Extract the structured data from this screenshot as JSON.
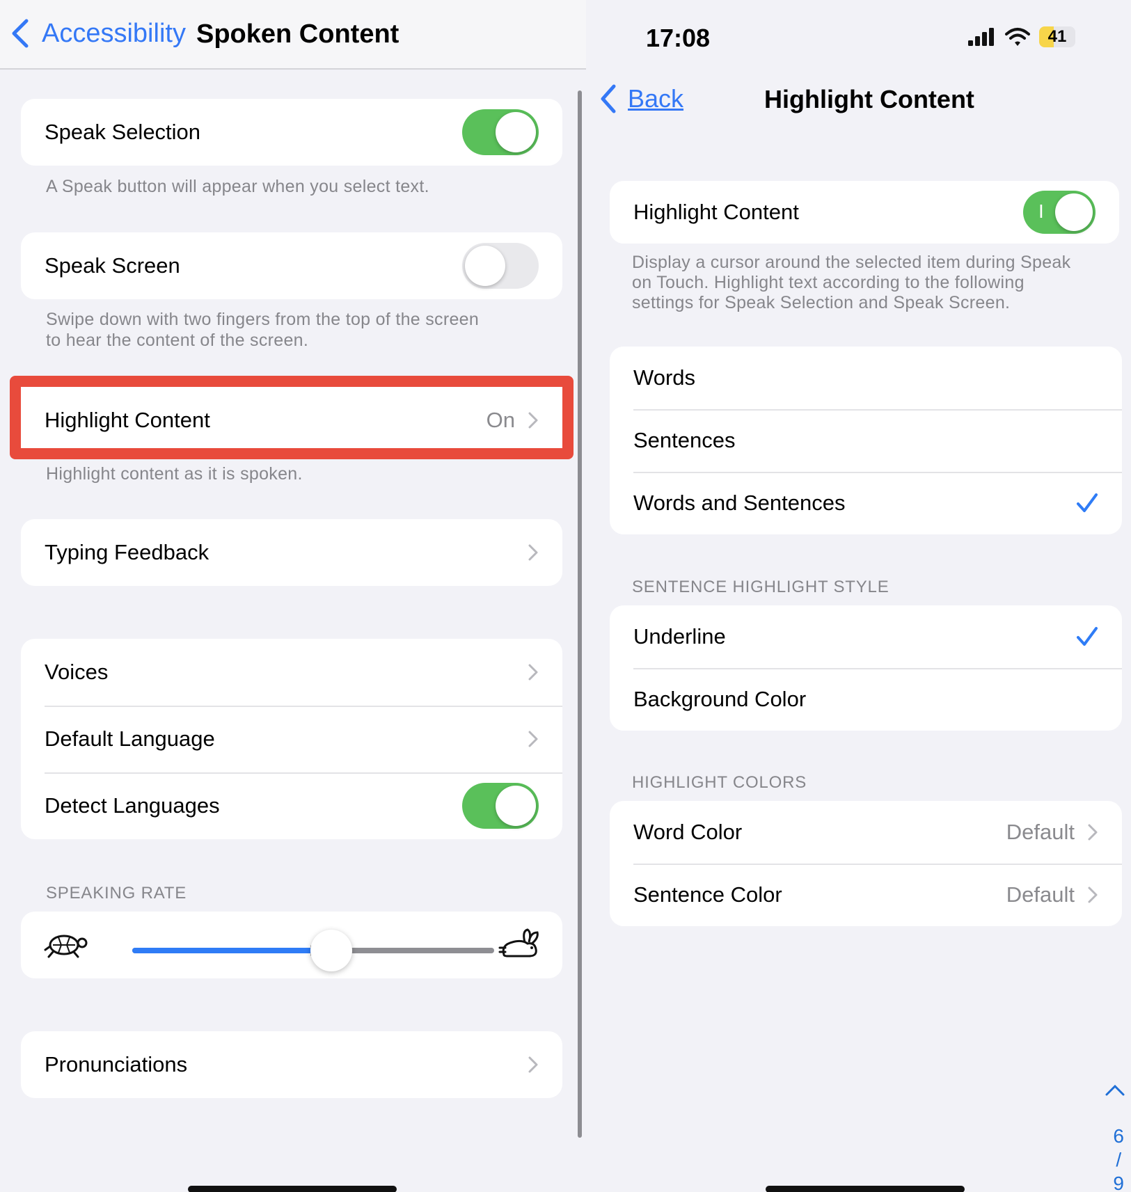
{
  "left": {
    "nav": {
      "back_label": "Accessibility",
      "title": "Spoken Content"
    },
    "speak_selection": {
      "label": "Speak Selection",
      "on": true,
      "note": "A Speak button will appear when you select text."
    },
    "speak_screen": {
      "label": "Speak Screen",
      "on": false,
      "note_line1": "Swipe down with two fingers from the top of the screen",
      "note_line2": "to hear the content of the screen."
    },
    "highlight_content": {
      "label": "Highlight Content",
      "value": "On",
      "note": "Highlight content as it is spoken."
    },
    "typing_feedback": {
      "label": "Typing Feedback"
    },
    "voices": {
      "label": "Voices"
    },
    "default_language": {
      "label": "Default Language"
    },
    "detect_languages": {
      "label": "Detect Languages",
      "on": true
    },
    "speaking_rate": {
      "header": "SPEAKING RATE",
      "value_fraction": 0.55,
      "slow_icon": "turtle-icon",
      "fast_icon": "rabbit-icon"
    },
    "pronunciations": {
      "label": "Pronunciations"
    }
  },
  "right": {
    "status": {
      "time": "17:08",
      "battery": "41",
      "battery_fraction": 0.41
    },
    "nav": {
      "back_label": "Back",
      "title": "Highlight Content"
    },
    "highlight_toggle": {
      "label": "Highlight Content",
      "on": true,
      "switch_mark": "I"
    },
    "description": {
      "line1": "Display a cursor around the selected item during Speak",
      "line2": "on Touch. Highlight text according to the following",
      "line3": "settings for Speak Selection and Speak Screen."
    },
    "mode_options": [
      {
        "label": "Words",
        "selected": false
      },
      {
        "label": "Sentences",
        "selected": false
      },
      {
        "label": "Words and Sentences",
        "selected": true
      }
    ],
    "sentence_style": {
      "header": "SENTENCE HIGHLIGHT STYLE",
      "options": [
        {
          "label": "Underline",
          "selected": true
        },
        {
          "label": "Background Color",
          "selected": false
        }
      ]
    },
    "highlight_colors": {
      "header": "HIGHLIGHT COLORS",
      "word_color": {
        "label": "Word Color",
        "value": "Default"
      },
      "sentence_color": {
        "label": "Sentence Color",
        "value": "Default"
      }
    },
    "pager": {
      "current": "6",
      "sep": "/",
      "total": "9"
    }
  },
  "colors": {
    "accent": "#3478f6",
    "toggle_on": "#5ac05a",
    "annotation_red": "#e84b3c",
    "check": "#2f7cf6"
  }
}
